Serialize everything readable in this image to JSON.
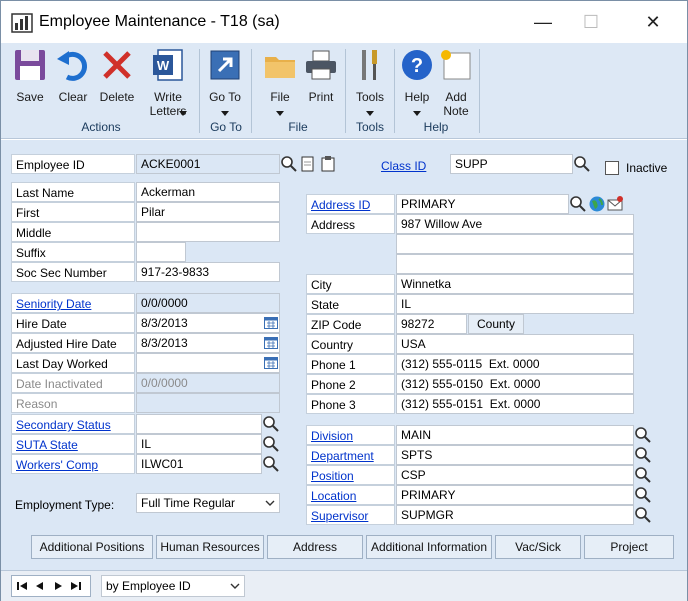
{
  "window": {
    "title": "Employee Maintenance  -  T18 (sa)",
    "min_label": "—",
    "max_label": "☐",
    "close_label": "✕"
  },
  "ribbon": {
    "buttons": [
      {
        "label": "Save",
        "icon": "save-icon"
      },
      {
        "label": "Clear",
        "icon": "undo-icon"
      },
      {
        "label": "Delete",
        "icon": "delete-icon"
      },
      {
        "label": "Write\nLetters",
        "icon": "word-icon"
      },
      {
        "label": "Go To",
        "icon": "goto-icon"
      },
      {
        "label": "File",
        "icon": "folder-icon"
      },
      {
        "label": "Print",
        "icon": "printer-icon"
      },
      {
        "label": "Tools",
        "icon": "tools-icon"
      },
      {
        "label": "Help",
        "icon": "help-icon"
      },
      {
        "label": "Add\nNote",
        "icon": "note-icon"
      }
    ],
    "groups": [
      "Actions",
      "Go To",
      "File",
      "Tools",
      "Help"
    ]
  },
  "form": {
    "employee_id_label": "Employee ID",
    "employee_id": "ACKE0001",
    "class_id_label": "Class ID",
    "class_id": "SUPP",
    "inactive_label": "Inactive",
    "last_name_label": "Last Name",
    "last_name": "Ackerman",
    "first_label": "First",
    "first": "Pilar",
    "middle_label": "Middle",
    "middle": "",
    "suffix_label": "Suffix",
    "suffix": "",
    "ssn_label": "Soc Sec Number",
    "ssn": "917-23-9833",
    "seniority_label": "Seniority Date",
    "seniority": "0/0/0000",
    "hire_label": "Hire Date",
    "hire": "8/3/2013",
    "adj_hire_label": "Adjusted Hire Date",
    "adj_hire": "8/3/2013",
    "last_day_label": "Last Day Worked",
    "last_day": "",
    "date_inactive_label": "Date Inactivated",
    "date_inactive": "0/0/0000",
    "reason_label": "Reason",
    "reason": "",
    "secondary_label": "Secondary Status",
    "secondary": "",
    "suta_label": "SUTA State",
    "suta": "IL",
    "workers_comp_label": "Workers' Comp",
    "workers_comp": "ILWC01",
    "emp_type_label": "Employment Type:",
    "emp_type": "Full Time Regular",
    "address_id_label": "Address ID",
    "address_id": "PRIMARY",
    "address_label": "Address",
    "address1": "987 Willow Ave",
    "address2": "",
    "address3": "",
    "city_label": "City",
    "city": "Winnetka",
    "state_label": "State",
    "state": "IL",
    "zip_label": "ZIP Code",
    "zip": "98272",
    "county_button": "County",
    "country_label": "Country",
    "country": "USA",
    "phone1_label": "Phone 1",
    "phone1": "(312) 555-0115  Ext. 0000",
    "phone2_label": "Phone 2",
    "phone2": "(312) 555-0150  Ext. 0000",
    "phone3_label": "Phone 3",
    "phone3": "(312) 555-0151  Ext. 0000",
    "division_label": "Division",
    "division": "MAIN",
    "department_label": "Department",
    "department": "SPTS",
    "position_label": "Position",
    "position": "CSP",
    "location_label": "Location",
    "location": "PRIMARY",
    "supervisor_label": "Supervisor",
    "supervisor": "SUPMGR"
  },
  "tabs": [
    "Additional Positions",
    "Human Resources",
    "Address",
    "Additional Information",
    "Vac/Sick",
    "Project"
  ],
  "statusbar": {
    "sort_by": "by Employee ID"
  },
  "colors": {
    "ribbon_bg": "#dde8f5",
    "content_bg": "#dbe7f5",
    "link": "#0033cc"
  }
}
